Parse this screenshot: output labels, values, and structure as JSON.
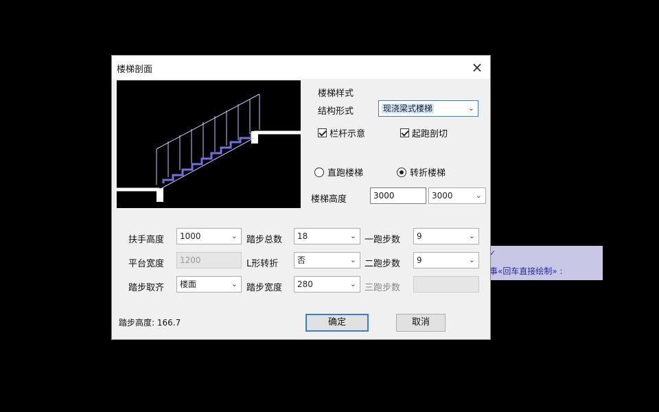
{
  "hint": {
    "line1": "✓",
    "line2": "事«回车直接绘制» :"
  },
  "dialog": {
    "title": "楼梯剖面",
    "close_icon": "×",
    "section_style": "楼梯样式",
    "structure_label": "结构形式",
    "structure_value": "现浇梁式楼梯",
    "railing_label": "栏杆示意",
    "railing_checked": true,
    "start_break_label": "起跑剖切",
    "start_break_checked": true,
    "straight_label": "直跑楼梯",
    "turn_label": "转折楼梯",
    "selected_type": "turn",
    "height_label": "楼梯高度",
    "height_input": "3000",
    "height_select": "3000",
    "handrail_label": "扶手高度",
    "handrail_value": "1000",
    "steps_total_label": "踏步总数",
    "steps_total_value": "18",
    "run1_label": "一跑步数",
    "run1_value": "9",
    "platform_label": "平台宽度",
    "platform_value": "1200",
    "l_turn_label": "L形转折",
    "l_turn_value": "否",
    "run2_label": "二跑步数",
    "run2_value": "9",
    "align_label": "踏步取齐",
    "align_value": "楼面",
    "step_width_label": "踏步宽度",
    "step_width_value": "280",
    "run3_label": "三跑步数",
    "run3_value": "",
    "step_height_text": "踏步高度: 166.7",
    "ok_label": "确定",
    "cancel_label": "取消"
  },
  "colors": {
    "accent": "#3a7bd5",
    "stairs": "#7070e0",
    "rails": "#c8c8ff"
  },
  "icons": {
    "arrow": "chevron-down-icon",
    "close": "close-icon"
  }
}
